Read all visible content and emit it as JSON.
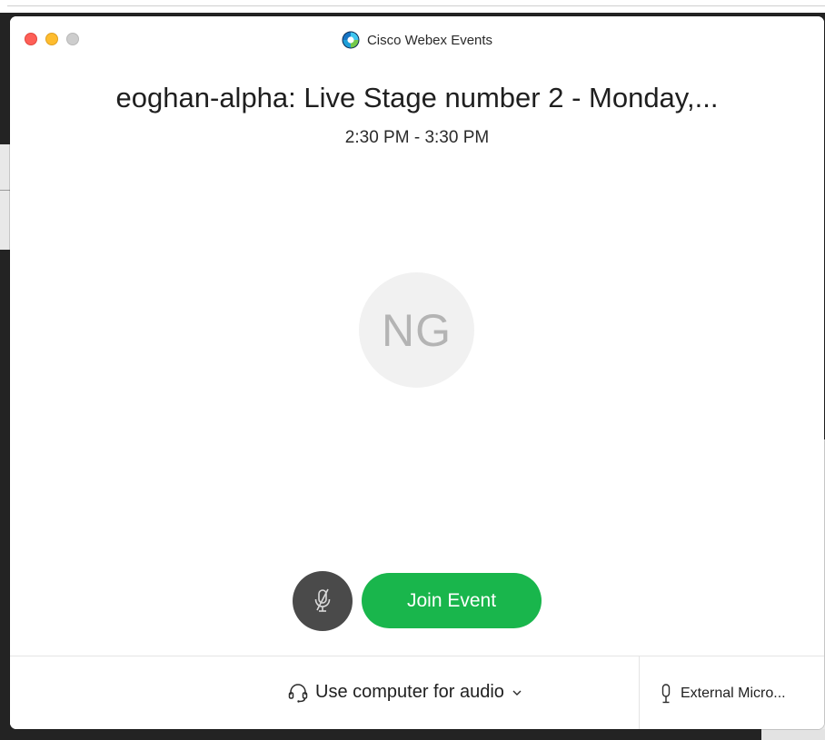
{
  "window": {
    "title": "Cisco Webex Events"
  },
  "event": {
    "title": "eoghan-alpha: Live Stage number 2 - Monday,...",
    "time": "2:30 PM - 3:30 PM"
  },
  "avatar": {
    "initials": "NG"
  },
  "controls": {
    "join_label": "Join Event",
    "mute_icon": "microphone-muted-icon"
  },
  "audio": {
    "selected": "Use computer for audio",
    "microphone": "External Micro..."
  },
  "colors": {
    "join_green": "#19b64c",
    "mute_button": "#4a4a4a",
    "avatar_bg": "#f1f1f1",
    "close": "#fe5f57",
    "minimize": "#febc2e",
    "maximize": "#cdcdcd"
  }
}
